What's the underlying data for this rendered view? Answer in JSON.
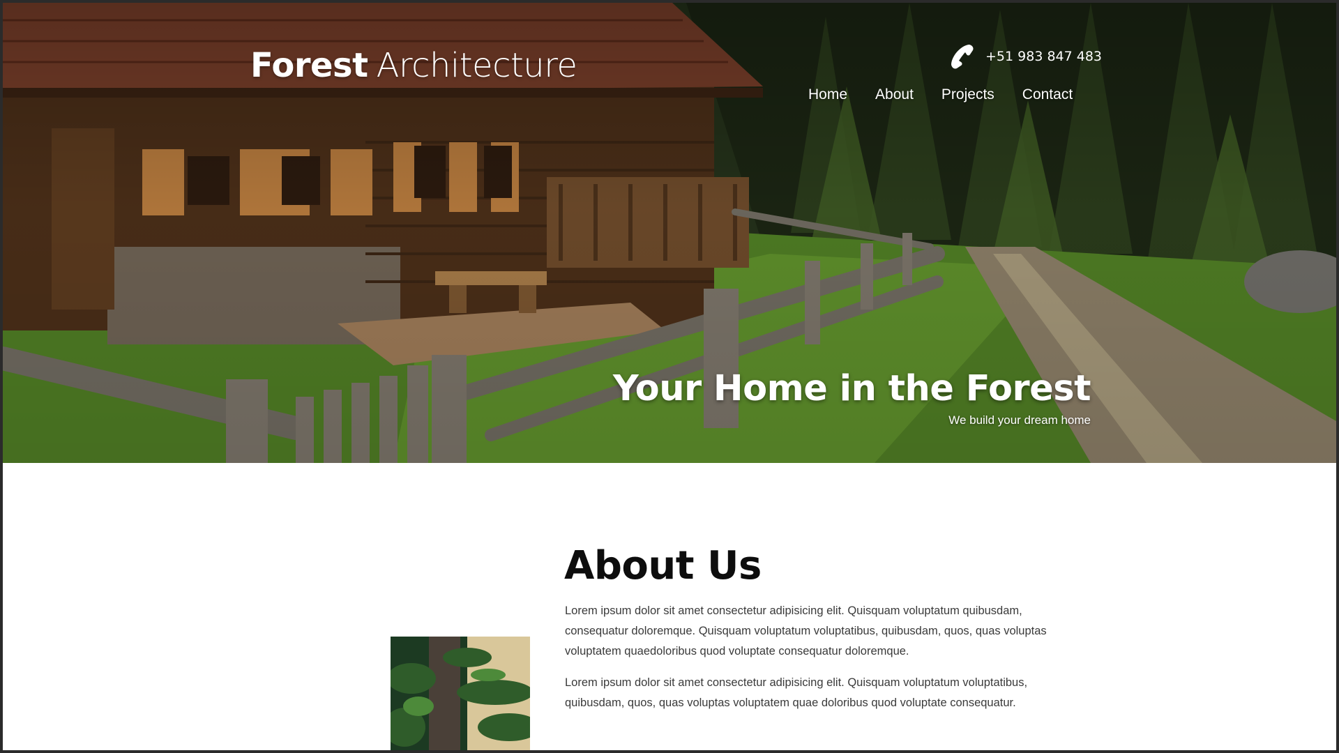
{
  "header": {
    "brand_bold": "Forest",
    "brand_light": "Architecture",
    "phone": "+51 983 847 483"
  },
  "nav": {
    "items": [
      {
        "label": "Home"
      },
      {
        "label": "About"
      },
      {
        "label": "Projects"
      },
      {
        "label": "Contact"
      }
    ]
  },
  "hero": {
    "title": "Your Home in the Forest",
    "subtitle": "We build your dream home"
  },
  "about": {
    "title": "About Us",
    "paragraphs": [
      "Lorem ipsum dolor sit amet consectetur adipisicing elit. Quisquam voluptatum quibusdam, consequatur doloremque. Quisquam voluptatum voluptatibus, quibusdam, quos, quas voluptas voluptatem quaedoloribus quod voluptate consequatur doloremque.",
      "Lorem ipsum dolor sit amet consectetur adipisicing elit. Quisquam voluptatum voluptatibus, quibusdam, quos, quas voluptas voluptatem quae doloribus quod voluptate consequatur."
    ]
  },
  "icons": {
    "phone": "phone-icon"
  },
  "colors": {
    "text_light": "#ffffff",
    "heading_dark": "#0d0d0d",
    "body_text": "#3a3a3a"
  }
}
